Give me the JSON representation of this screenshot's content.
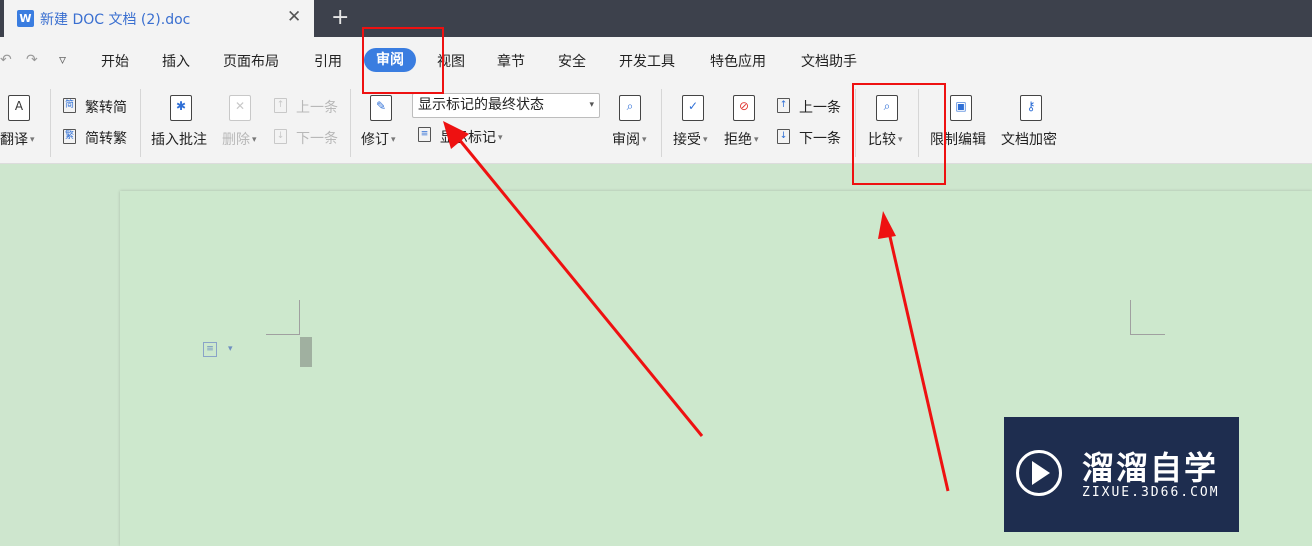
{
  "titlebar": {
    "tab_title": "新建 DOC 文档 (2).doc",
    "tab_icon": "W",
    "close_glyph": "✕",
    "new_tab_glyph": "+"
  },
  "quick_access": {
    "undo": "↶",
    "redo": "↷",
    "more": "▿"
  },
  "menu": {
    "items": [
      "开始",
      "插入",
      "页面布局",
      "引用",
      "审阅",
      "视图",
      "章节",
      "安全",
      "开发工具",
      "特色应用",
      "文档助手"
    ],
    "active_index": 4
  },
  "ribbon": {
    "translate": "翻译",
    "trad_to_simp": "繁转简",
    "simp_to_trad": "简转繁",
    "insert_comment": "插入批注",
    "delete": "删除",
    "prev_comment": "上一条",
    "next_comment": "下一条",
    "track_changes": "修订",
    "markup_mode": "显示标记的最终状态",
    "show_markup": "显示标记",
    "review_pane": "审阅",
    "accept": "接受",
    "reject": "拒绝",
    "prev_change": "上一条",
    "next_change": "下一条",
    "compare": "比较",
    "restrict_editing": "限制编辑",
    "doc_encrypt": "文档加密"
  },
  "watermark": {
    "title": "溜溜自学",
    "subtitle": "ZIXUE.3D66.COM"
  },
  "colors": {
    "accent": "#3a7de0",
    "titlebar": "#3d414c",
    "annotation": "#ee1111",
    "doc_background": "#cee6ce"
  }
}
